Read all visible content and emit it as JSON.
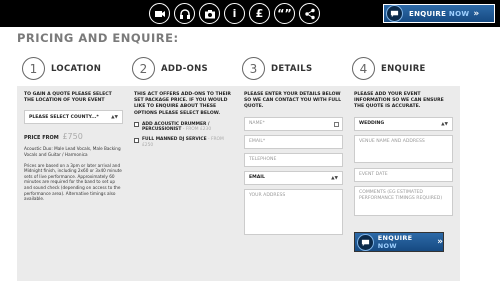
{
  "topbar": {
    "icons": [
      "video-camera-icon",
      "headphones-icon",
      "camera-icon",
      "info-icon",
      "pound-icon",
      "quote-icon",
      "share-icon"
    ],
    "icon_glyphs": {
      "info": "i",
      "pound": "£",
      "quote": "“”"
    },
    "enquire_label": "ENQUIRE",
    "enquire_now": "NOW",
    "enquire_chevron": "»"
  },
  "heading": "PRICING AND ENQUIRE:",
  "steps": [
    {
      "num": "1",
      "title": "LOCATION",
      "intro": "TO GAIN A QUOTE PLEASE SELECT THE LOCATION OF YOUR EVENT",
      "county_select": "PLEASE SELECT COUNTY...*",
      "price_label": "PRICE FROM",
      "price_value": "£750",
      "description": "Acoustic Duo: Male Lead Vocals, Male Backing Vocals and Guitar / Harmonica",
      "details": "Prices are based on a 3pm or later arrival and Midnight finish, including 2x60 or 3x40 minute sets of live performance. Approximately 60 minutes are required for the band to set up and sound check (depending on access to the performance area). Alternative timings also available."
    },
    {
      "num": "2",
      "title": "ADD-ONS",
      "intro": "THIS ACT OFFERS ADD-ONS TO THEIR SET PACKAGE PRICE. IF YOU WOULD LIKE TO ENQUIRE ABOUT THESE OPTIONS PLEASE SELECT BELOW.",
      "addons": [
        {
          "label": "ADD ACOUSTIC DRUMMER / PERCUSSIONIST",
          "price": " - FROM £230"
        },
        {
          "label": "FULL MANNED DJ SERVICE",
          "price": " - FROM £250"
        }
      ]
    },
    {
      "num": "3",
      "title": "DETAILS",
      "intro": "PLEASE ENTER YOUR DETAILS BELOW SO WE CAN CONTACT YOU WITH FULL QUOTE.",
      "name_placeholder": "NAME*",
      "email_placeholder": "EMAIL*",
      "telephone_placeholder": "TELEPHONE",
      "contact_method": "EMAIL",
      "address_placeholder": "YOUR ADDRESS"
    },
    {
      "num": "4",
      "title": "ENQUIRE",
      "intro": "PLEASE ADD YOUR EVENT INFORMATION SO WE CAN ENSURE THE QUOTE IS ACCURATE.",
      "event_type": "WEDDING",
      "venue_placeholder": "VENUE NAME AND ADDRESS",
      "date_placeholder": "EVENT DATE",
      "comments_placeholder": "COMMENTS (EG ESTIMATED PERFORMANCE TIMINGS REQUIRED)",
      "submit_label": "ENQUIRE",
      "submit_now": "NOW",
      "submit_chevron": "»"
    }
  ],
  "colors": {
    "accent_blue": "#1f5c99",
    "topbar": "#000000",
    "panel": "#ebebeb"
  }
}
